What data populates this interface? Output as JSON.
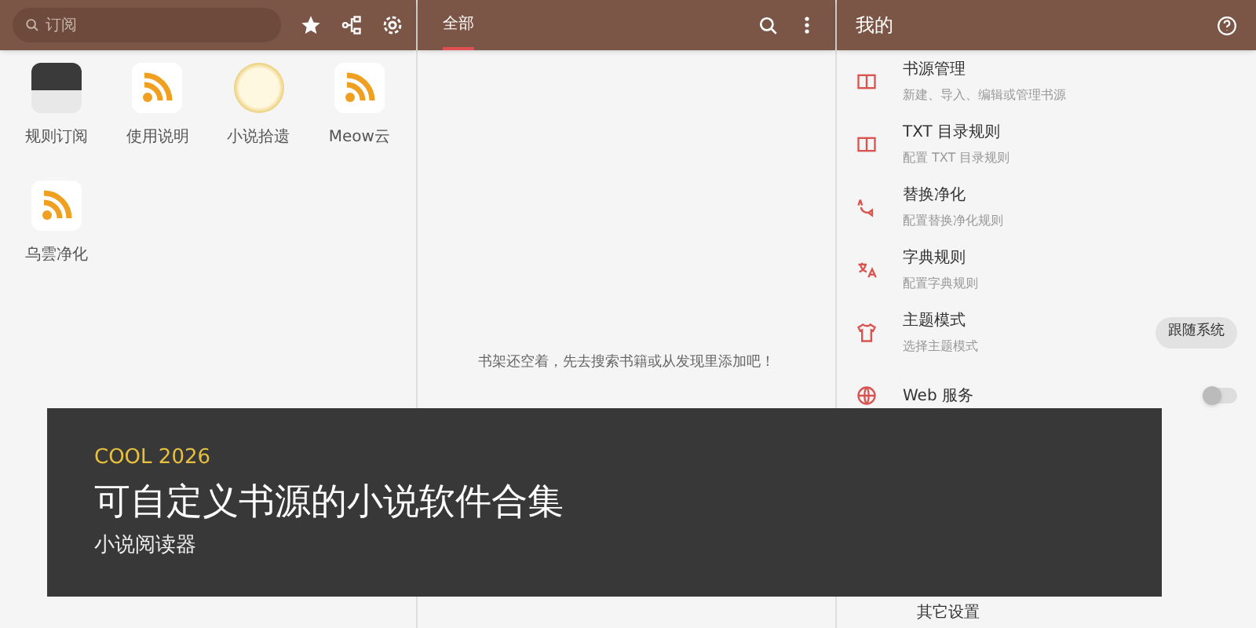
{
  "subscriptions": {
    "search": {
      "placeholder": "订阅"
    },
    "items": [
      {
        "label": "规则订阅",
        "kind": "image"
      },
      {
        "label": "使用说明",
        "kind": "rss"
      },
      {
        "label": "小说拾遗",
        "kind": "badge"
      },
      {
        "label": "Meow云",
        "kind": "rss"
      },
      {
        "label": "乌雲净化",
        "kind": "rss"
      }
    ]
  },
  "bookshelf": {
    "tabs": [
      {
        "label": "全部",
        "selected": true
      }
    ],
    "empty_message": "书架还空着，先去搜索书籍或从发现里添加吧！"
  },
  "mine": {
    "title": "我的",
    "items": [
      {
        "title": "书源管理",
        "subtitle": "新建、导入、编辑或管理书源",
        "kind": "book"
      },
      {
        "title": "TXT 目录规则",
        "subtitle": "配置 TXT 目录规则",
        "kind": "book"
      },
      {
        "title": "替换净化",
        "subtitle": "配置替换净化规则",
        "kind": "replace"
      },
      {
        "title": "字典规则",
        "subtitle": "配置字典规则",
        "kind": "translate"
      },
      {
        "title": "主题模式",
        "subtitle": "选择主题模式",
        "kind": "shirt",
        "value": "跟随系统"
      },
      {
        "title": "Web 服务",
        "kind": "globe",
        "on": false
      }
    ],
    "bottom_item": "其它设置"
  },
  "banner": {
    "eyebrow": "COOL 2026",
    "title": "可自定义书源的小说软件合集",
    "subtitle": "小说阅读器"
  }
}
